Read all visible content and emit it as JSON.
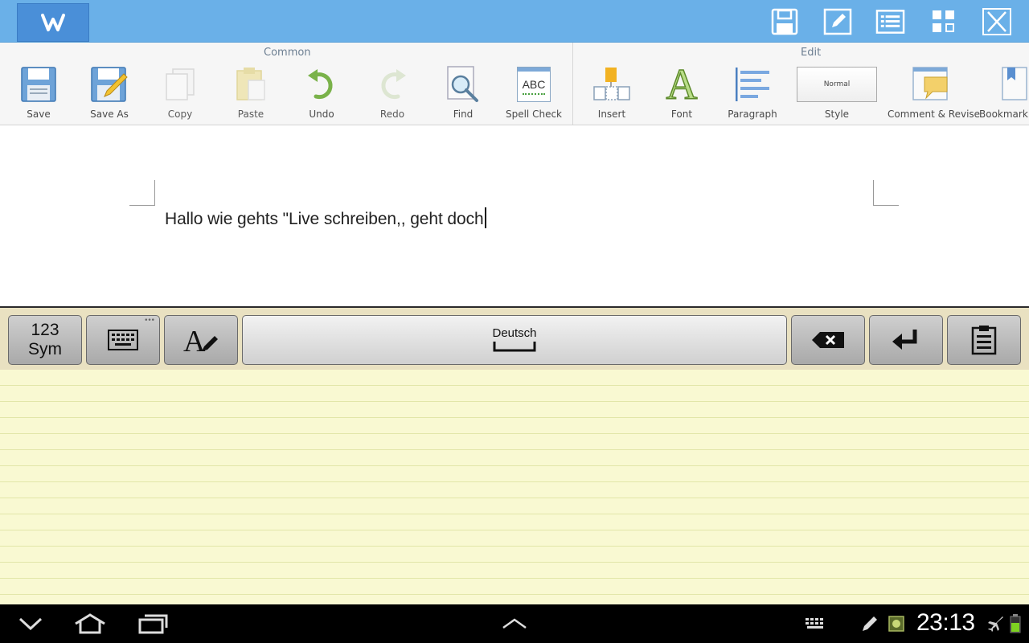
{
  "titlebar": {
    "logo_letter": "W",
    "actions": [
      "save-icon",
      "edit-icon",
      "list-icon",
      "grid-icon",
      "close-icon"
    ]
  },
  "ribbon": {
    "groups": {
      "common": "Common",
      "edit": "Edit"
    },
    "common_buttons": {
      "save": "Save",
      "save_as": "Save As",
      "copy": "Copy",
      "paste": "Paste",
      "undo": "Undo",
      "redo": "Redo",
      "find": "Find",
      "spell_check": "Spell Check",
      "spell_icon_text": "ABC"
    },
    "edit_buttons": {
      "insert": "Insert",
      "font": "Font",
      "font_icon_letter": "A",
      "paragraph": "Paragraph",
      "style": "Style",
      "style_preview": "Normal",
      "comment_revise": "Comment & Revise",
      "bookmark": "Bookmark"
    }
  },
  "document": {
    "text": "Hallo wie gehts \"Live schreiben,, geht doch"
  },
  "keyboard": {
    "sym_line1": "123",
    "sym_line2": "Sym",
    "space_label": "Deutsch",
    "more_dots": "•••"
  },
  "statusbar": {
    "clock": "23:13"
  },
  "colors": {
    "titlebar": "#6ab0e8",
    "ribbon": "#f6f6f6",
    "pad": "#f9f9d2",
    "keyboard_bar": "#e9e1c1",
    "statusbar": "#000000"
  }
}
